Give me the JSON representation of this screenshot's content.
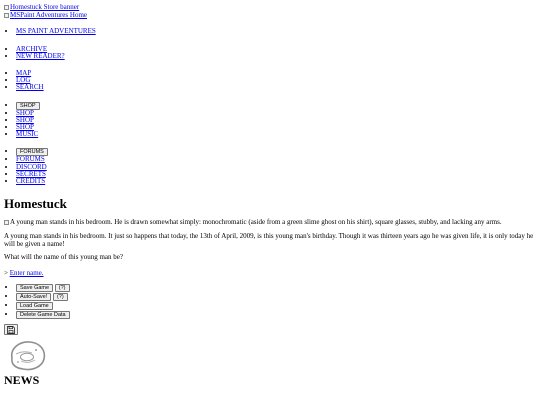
{
  "header": {
    "banner_alt": "Homestuck Store banner",
    "home_alt": "MSPaint Adventures Home"
  },
  "nav": {
    "group1": [
      "MS PAINT ADVENTURES"
    ],
    "group2": [
      "ARCHIVE",
      "NEW READER?"
    ],
    "group3": [
      "MAP",
      "LOG",
      "SEARCH"
    ],
    "shop_toggle": "SHOP",
    "shop_links": [
      "SHOP",
      "SHOP",
      "SHOP",
      "MUSIC"
    ],
    "forums_toggle": "FORUMS",
    "community_links": [
      "FORUMS",
      "DISCORD",
      "SECRETS",
      "CREDITS"
    ]
  },
  "page": {
    "title": "Homestuck",
    "image_alt": "A young man stands in his bedroom. He is drawn somewhat simply: monochromatic (aside from a green slime ghost on his shirt), square glasses, stubby, and lacking any arms.",
    "body_text": "A young man stands in his bedroom. It just so happens that today, the 13th of April, 2009, is this young man's birthday. Though it was thirteen years ago he was given life, it is only today he will be given a name!",
    "prompt_text": "What will the name of this young man be?",
    "command_prefix": ">",
    "command_link": "Enter name."
  },
  "save_menu": {
    "save_game": "Save Game",
    "save_help": "(?)",
    "auto_save": "Auto-Save!",
    "auto_help": "(?)",
    "load_game": "Load Game",
    "delete_data": "Delete Game Data"
  },
  "news": {
    "heading": "NEWS"
  },
  "icons": {
    "broken_image": "broken-image-icon",
    "floppy": "floppy-disk-icon",
    "scratch": "scratch-doodle-icon"
  }
}
